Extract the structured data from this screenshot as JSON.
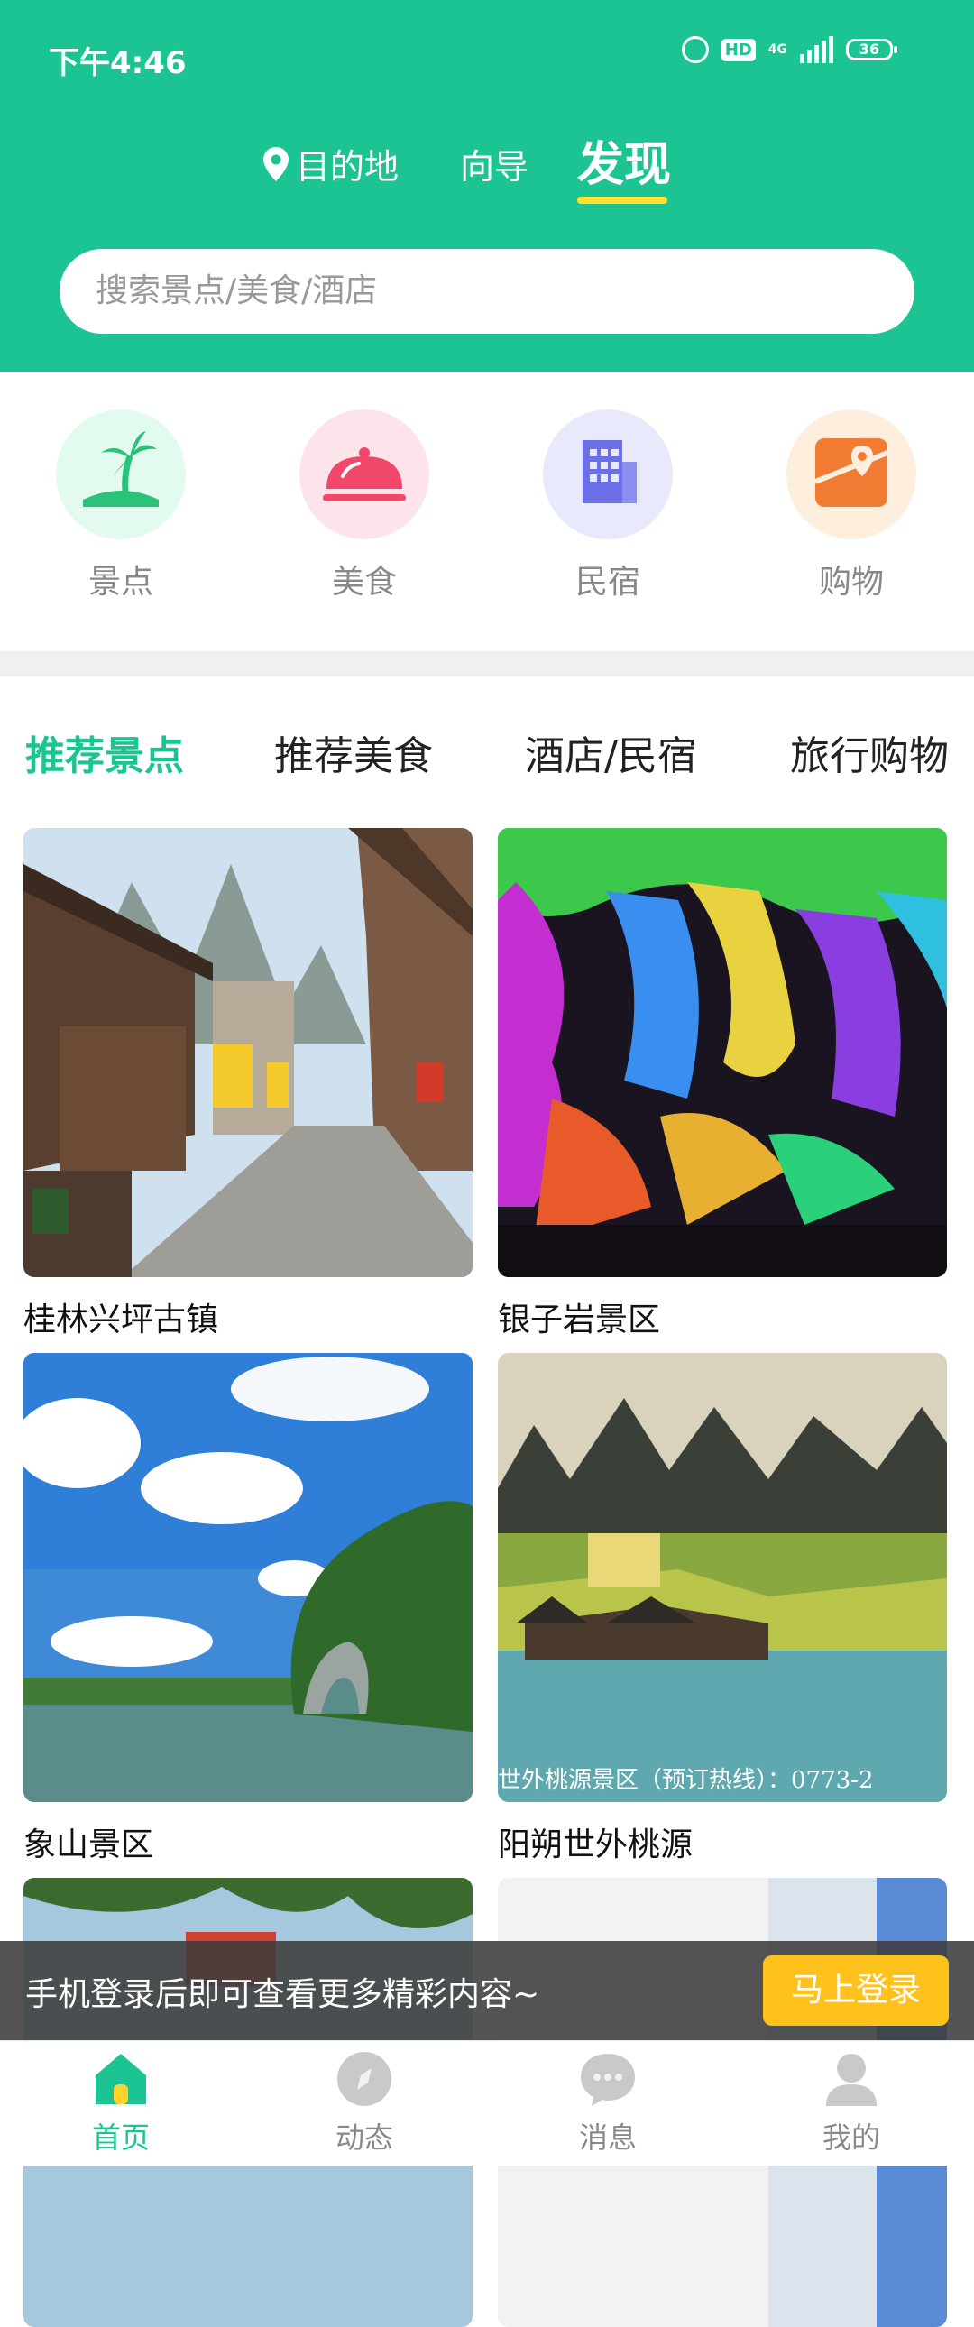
{
  "status_bar": {
    "time": "下午4:46",
    "net": "4G",
    "hd": "HD",
    "battery": "36"
  },
  "top_nav": {
    "destination": "目的地",
    "guide": "向导",
    "discover": "发现"
  },
  "search": {
    "placeholder": "搜索景点/美食/酒店"
  },
  "categories": [
    {
      "label": "景点",
      "icon": "palm-island-icon",
      "bg": "#e3faee",
      "color": "#2bc37a"
    },
    {
      "label": "美食",
      "icon": "food-cloche-icon",
      "bg": "#fde4ea",
      "color": "#f0476a"
    },
    {
      "label": "民宿",
      "icon": "building-icon",
      "bg": "#e8e9fb",
      "color": "#6b70e8"
    },
    {
      "label": "购物",
      "icon": "map-pin-icon",
      "bg": "#fdeede",
      "color": "#f27b33"
    }
  ],
  "tabs": [
    "推荐景点",
    "推荐美食",
    "酒店/民宿",
    "旅行购物"
  ],
  "places": [
    {
      "title": "桂林兴坪古镇"
    },
    {
      "title": "银子岩景区"
    },
    {
      "title": "象山景区"
    },
    {
      "title": "阳朔世外桃源",
      "watermark": "世外桃源景区（预订热线）：0773-2"
    }
  ],
  "login_bar": {
    "text": "手机登录后即可查看更多精彩内容~",
    "button": "马上登录"
  },
  "bottom_tabs": [
    "首页",
    "动态",
    "消息",
    "我的"
  ],
  "colors": {
    "primary": "#1dc493",
    "accent": "#ffe033",
    "login_button": "#ffc21d"
  }
}
